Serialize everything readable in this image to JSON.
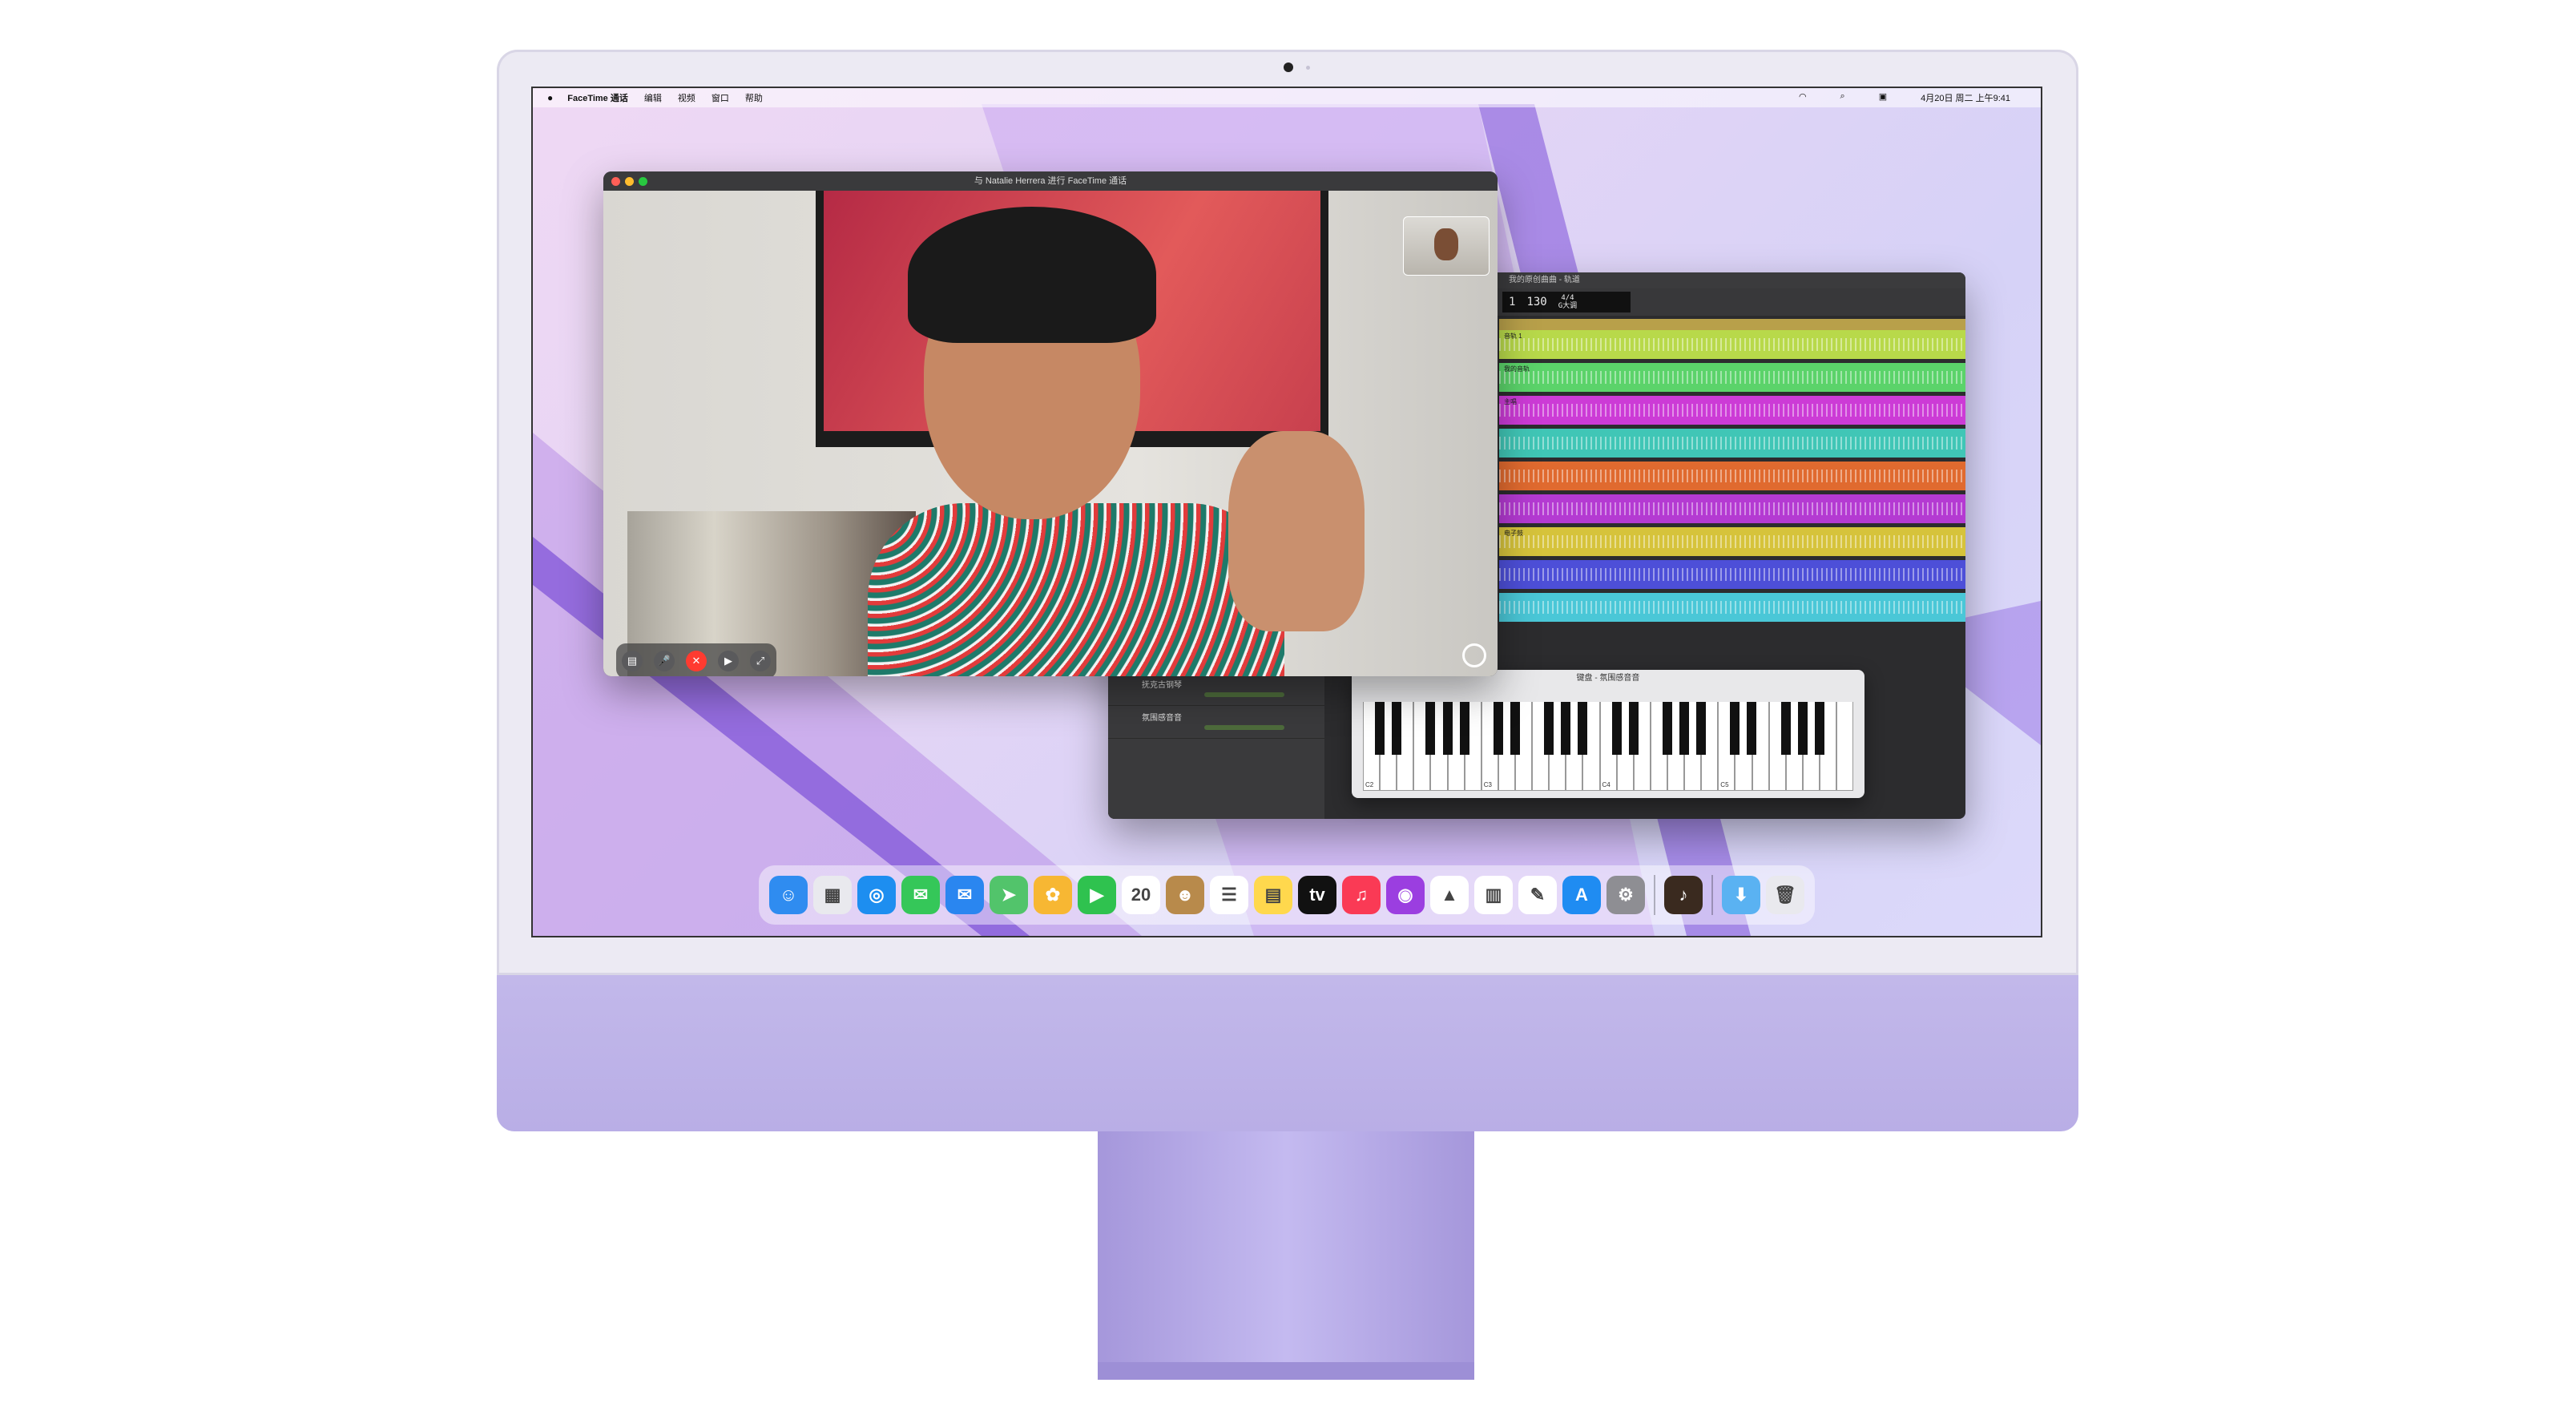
{
  "menubar": {
    "apple": "",
    "app": "FaceTime 通话",
    "items": [
      "编辑",
      "视频",
      "窗口",
      "帮助"
    ],
    "clock": "4月20日 周二 上午9:41"
  },
  "facetime": {
    "window_title": "与 Natalie Herrera 进行 FaceTime 通话"
  },
  "garageband": {
    "window_title": "我的原创曲曲 - 轨道",
    "bar": "1",
    "tempo": "130",
    "signature": "4/4",
    "key": "G大调",
    "tracks": [
      {
        "name": "音轨 1",
        "color": "#b8d94a"
      },
      {
        "name": "我的音轨",
        "color": "#5bd36a"
      },
      {
        "name": "主唱",
        "color": "#cc3bd6"
      },
      {
        "name": "",
        "color": "#40c6b6"
      },
      {
        "name": "",
        "color": "#e06a2f"
      },
      {
        "name": "",
        "color": "#b43ad2"
      },
      {
        "name": "电子鼓",
        "color": "#d6c33b"
      },
      {
        "name": "",
        "color": "#4d4fd8"
      },
      {
        "name": "",
        "color": "#4ac7d7"
      }
    ],
    "mixer": [
      {
        "label": "抚克古钢琴"
      },
      {
        "label": "氛围感音音"
      }
    ],
    "keyboard_title": "键盘 - 氛围感音音",
    "keyboard_labels": [
      "C2",
      "C3",
      "C4",
      "C5"
    ]
  },
  "dock": {
    "apps": [
      {
        "name": "finder-icon",
        "color": "#2f8cf0",
        "glyph": "☺"
      },
      {
        "name": "launchpad-icon",
        "color": "#e9e9ee",
        "glyph": "▦"
      },
      {
        "name": "safari-icon",
        "color": "#1d8ef0",
        "glyph": "◎"
      },
      {
        "name": "messages-icon",
        "color": "#35c759",
        "glyph": "✉"
      },
      {
        "name": "mail-icon",
        "color": "#2a86f0",
        "glyph": "✉"
      },
      {
        "name": "maps-icon",
        "color": "#52c46b",
        "glyph": "➤"
      },
      {
        "name": "photos-icon",
        "color": "#f7b733",
        "glyph": "✿"
      },
      {
        "name": "facetime-icon",
        "color": "#2fc24f",
        "glyph": "▶"
      },
      {
        "name": "calendar-icon",
        "color": "#ffffff",
        "glyph": "20"
      },
      {
        "name": "contacts-icon",
        "color": "#b88a4b",
        "glyph": "☻"
      },
      {
        "name": "reminders-icon",
        "color": "#ffffff",
        "glyph": "☰"
      },
      {
        "name": "notes-icon",
        "color": "#ffd84d",
        "glyph": "▤"
      },
      {
        "name": "appletv-icon",
        "color": "#111111",
        "glyph": "tv"
      },
      {
        "name": "music-icon",
        "color": "#fa3a55",
        "glyph": "♫"
      },
      {
        "name": "podcasts-icon",
        "color": "#9b3ee0",
        "glyph": "◉"
      },
      {
        "name": "keynote-icon",
        "color": "#ffffff",
        "glyph": "▲"
      },
      {
        "name": "numbers-icon",
        "color": "#ffffff",
        "glyph": "▥"
      },
      {
        "name": "pages-icon",
        "color": "#ffffff",
        "glyph": "✎"
      },
      {
        "name": "appstore-icon",
        "color": "#1f8cf2",
        "glyph": "A"
      },
      {
        "name": "systemprefs-icon",
        "color": "#8e8e93",
        "glyph": "⚙"
      },
      {
        "name": "garageband-icon",
        "color": "#3a2a1f",
        "glyph": "♪"
      },
      {
        "name": "downloads-folder-icon",
        "color": "#5ab2f2",
        "glyph": "⬇"
      },
      {
        "name": "trash-icon",
        "color": "#e9e9ee",
        "glyph": "🗑"
      }
    ]
  }
}
